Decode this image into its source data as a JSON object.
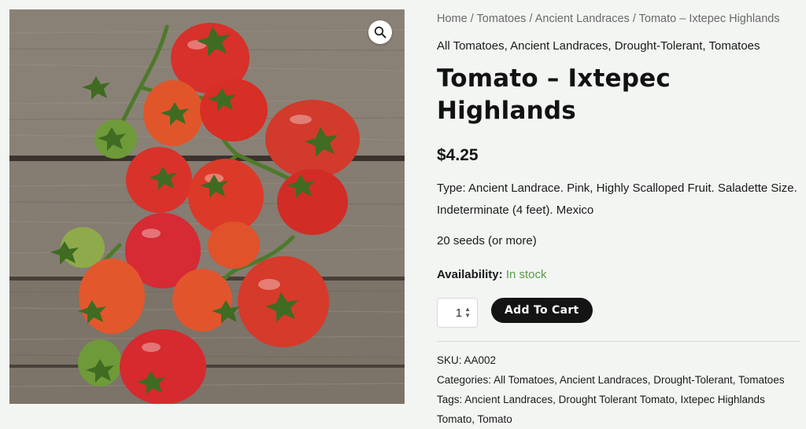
{
  "product_image": {
    "alt": "Tomato – Ixtepec Highlands",
    "zoom_icon": "magnifier-icon"
  },
  "breadcrumb": {
    "items": [
      "Home",
      "Tomatoes",
      "Ancient Landraces",
      "Tomato – Ixtepec Highlands"
    ],
    "separator": "/"
  },
  "categories_top": "All Tomatoes, Ancient Landraces, Drought-Tolerant, Tomatoes",
  "title": "Tomato – Ixtepec Highlands",
  "price": "$4.25",
  "description": {
    "line1": "Type: Ancient Landrace. Pink, Highly Scalloped Fruit. Saladette Size.",
    "line2": "Indeterminate (4 feet). Mexico"
  },
  "seeds": "20 seeds (or more)",
  "availability": {
    "label": "Availability:",
    "value": "In stock",
    "color": "#5a9a4a"
  },
  "quantity": {
    "value": "1"
  },
  "add_to_cart": {
    "label": "Add To Cart"
  },
  "meta": {
    "sku_label": "SKU:",
    "sku": "AA002",
    "categories_label": "Categories:",
    "categories": [
      "All Tomatoes",
      "Ancient Landraces",
      "Drought-Tolerant",
      "Tomatoes"
    ],
    "tags_label": "Tags:",
    "tags": [
      "Ancient Landraces",
      "Drought Tolerant Tomato",
      "Ixtepec Highlands Tomato",
      "Tomato"
    ]
  },
  "colors": {
    "background": "#f2f5f2",
    "button": "#141414",
    "in_stock": "#5a9a4a"
  }
}
